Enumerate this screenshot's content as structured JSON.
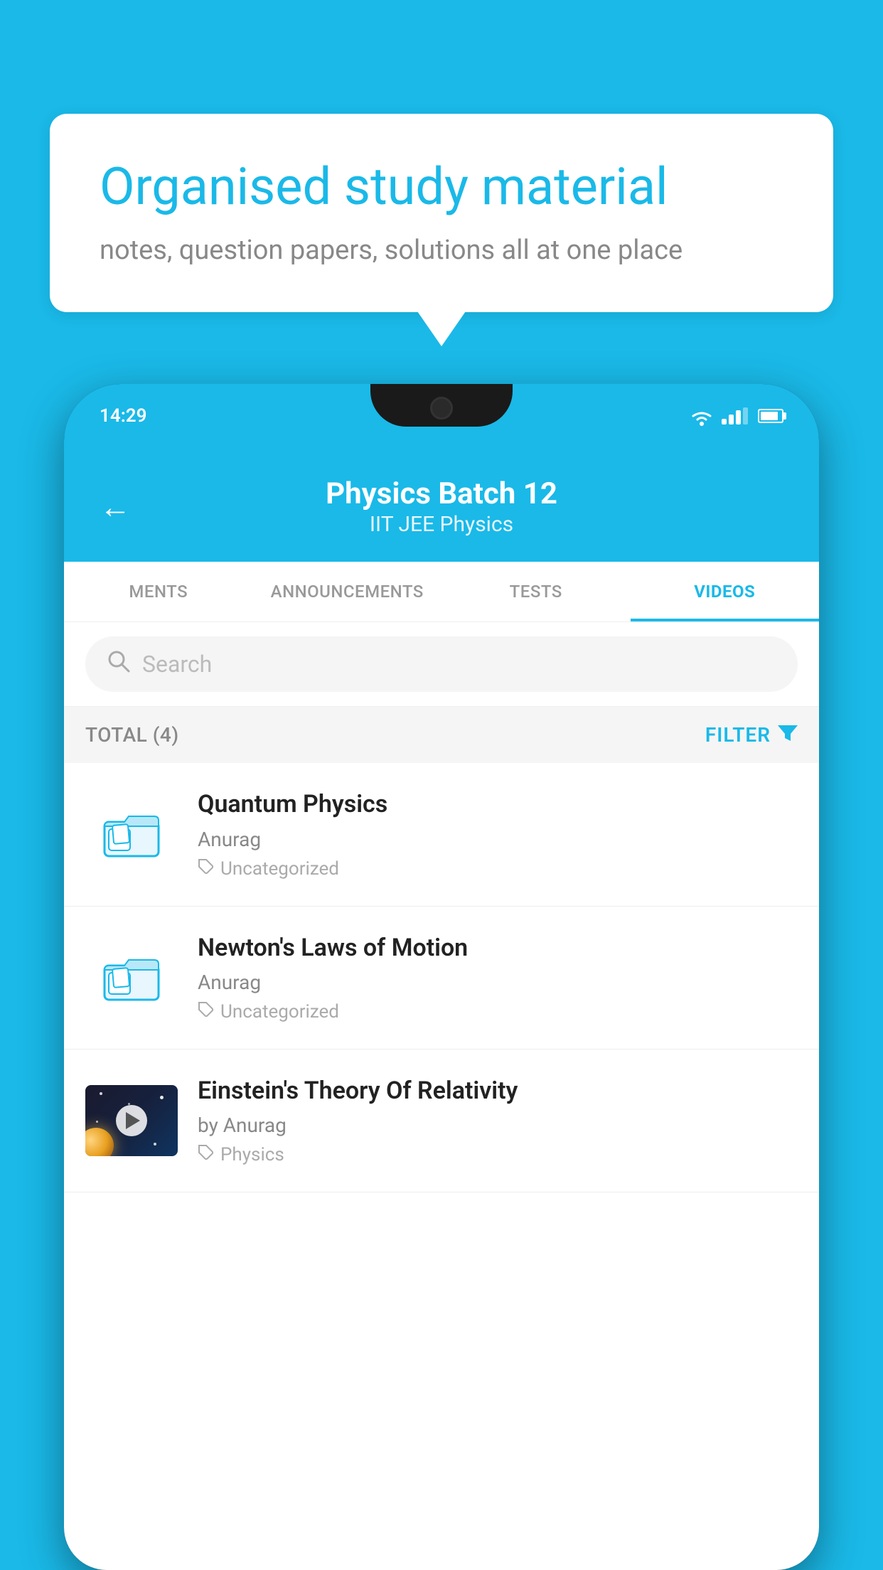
{
  "background": {
    "color": "#1ab9e8"
  },
  "speech_bubble": {
    "title": "Organised study material",
    "subtitle": "notes, question papers, solutions all at one place"
  },
  "phone": {
    "status_bar": {
      "time": "14:29"
    },
    "header": {
      "title": "Physics Batch 12",
      "subtitle": "IIT JEE    Physics",
      "back_label": "←"
    },
    "tabs": [
      {
        "label": "MENTS",
        "active": false
      },
      {
        "label": "ANNOUNCEMENTS",
        "active": false
      },
      {
        "label": "TESTS",
        "active": false
      },
      {
        "label": "VIDEOS",
        "active": true
      }
    ],
    "search": {
      "placeholder": "Search"
    },
    "filter_row": {
      "total_label": "TOTAL (4)",
      "filter_label": "FILTER"
    },
    "videos": [
      {
        "id": "1",
        "title": "Quantum Physics",
        "author": "Anurag",
        "tag": "Uncategorized",
        "type": "folder",
        "has_thumbnail": false
      },
      {
        "id": "2",
        "title": "Newton's Laws of Motion",
        "author": "Anurag",
        "tag": "Uncategorized",
        "type": "folder",
        "has_thumbnail": false
      },
      {
        "id": "3",
        "title": "Einstein's Theory Of Relativity",
        "author": "by Anurag",
        "tag": "Physics",
        "type": "video",
        "has_thumbnail": true
      }
    ]
  }
}
